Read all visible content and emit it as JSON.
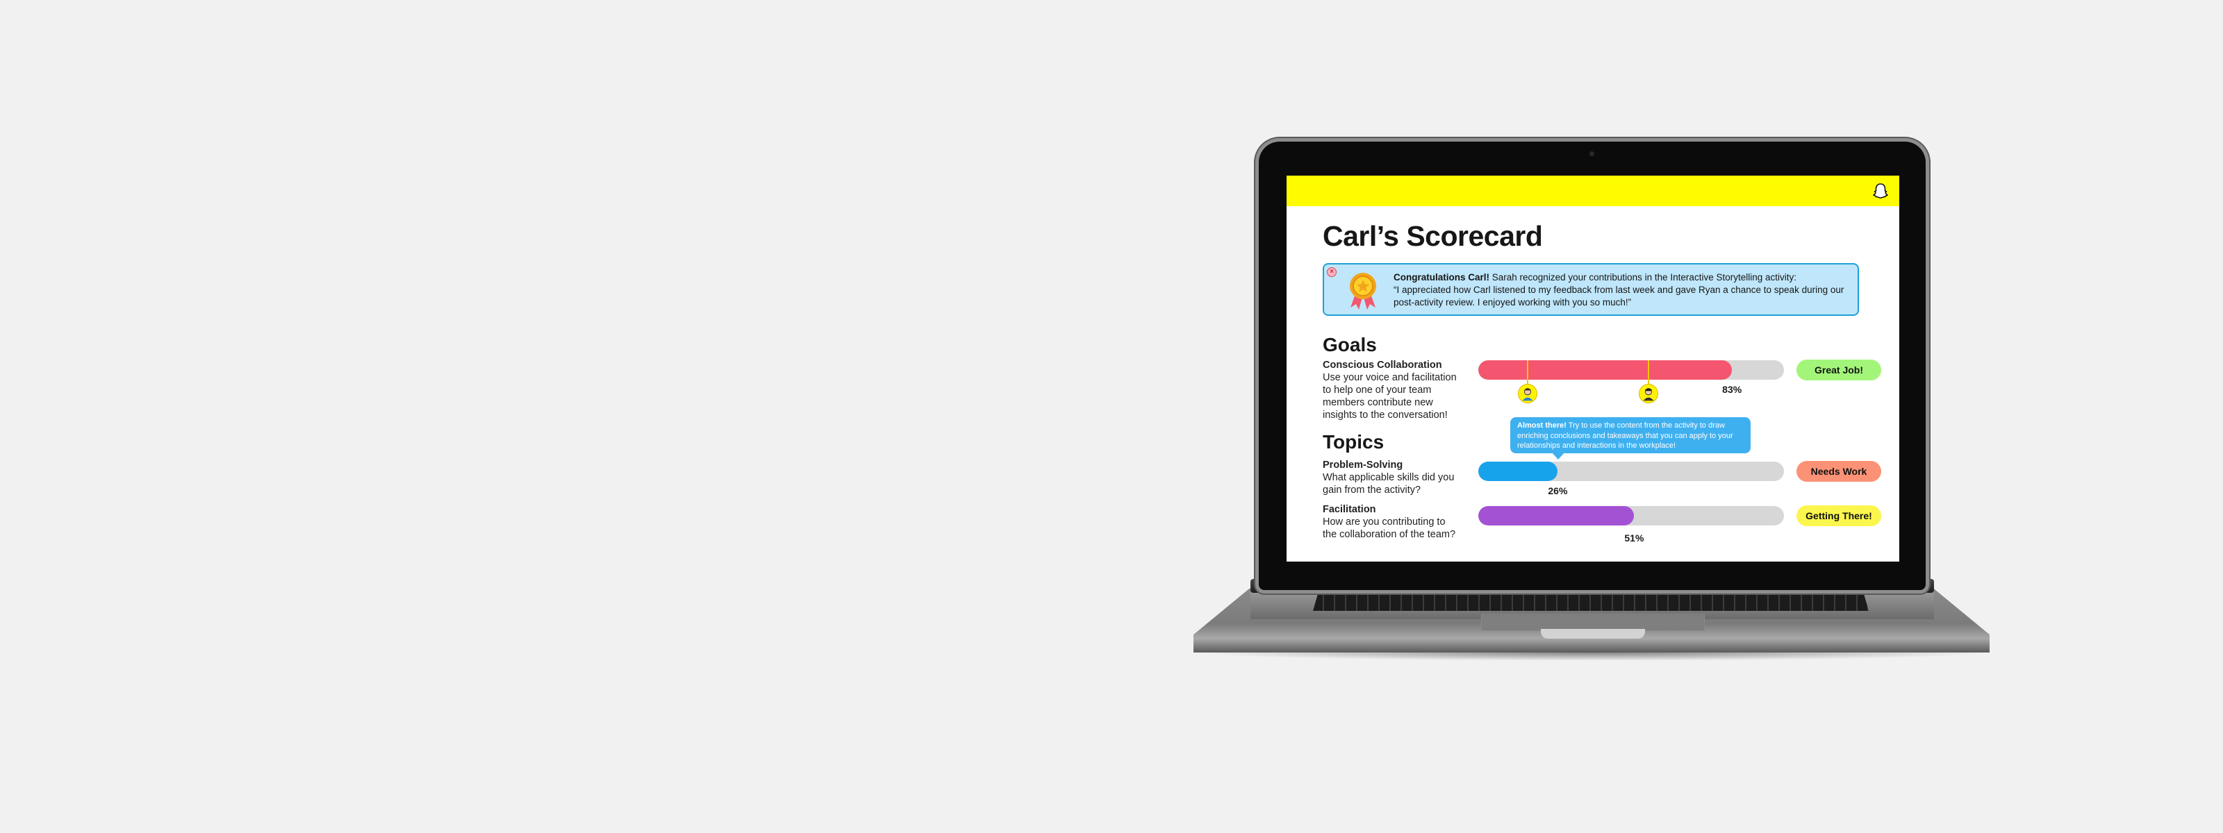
{
  "scorecard": {
    "title": "Carl’s Scorecard",
    "banner": {
      "close_label": "×",
      "lead": "Congratulations Carl!",
      "message": " Sarah recognized your contributions in the Interactive Storytelling activity:",
      "quote": "“I appreciated how Carl listened to my feedback from last week and gave Ryan a chance to speak during our post-activity review. I enjoyed working with you so much!”"
    },
    "goals": {
      "heading": "Goals",
      "items": [
        {
          "name": "Conscious Collaboration",
          "description": "Use your voice and facilitation to help one of your team members contribute new insights to the conversation!",
          "progress": 0.83,
          "percent_label": "83%",
          "bar_color": "#f4566f",
          "status": "Great Job!",
          "status_color": "#a3f57a"
        }
      ]
    },
    "tooltip": {
      "lead": "Almost there!",
      "text": " Try to use the content from the activity to draw enriching conclusions and takeaways that you can apply to your relationships and interactions in the workplace!"
    },
    "topics": {
      "heading": "Topics",
      "items": [
        {
          "name": "Problem-Solving",
          "description": "What applicable skills did you gain from the activity?",
          "progress": 0.26,
          "percent_label": "26%",
          "bar_color": "#17a3ec",
          "status": "Needs Work",
          "status_color": "#fb9276"
        },
        {
          "name": "Facilitation",
          "description": "How are you contributing to the collaboration of the team?",
          "progress": 0.51,
          "percent_label": "51%",
          "bar_color": "#a452d4",
          "status": "Getting There!",
          "status_color": "#fbf64d"
        }
      ]
    },
    "colors": {
      "topbar": "#fffc00",
      "banner_bg": "#bfe6fa",
      "banner_border": "#1fa0d6",
      "tooltip_bg": "#3fb0ef"
    },
    "icons": [
      "ghost-icon",
      "close-icon",
      "medal-icon",
      "avatar"
    ]
  }
}
